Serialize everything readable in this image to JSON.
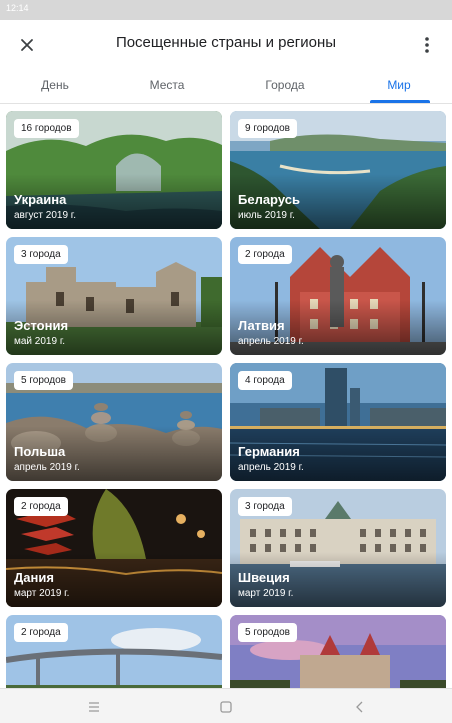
{
  "status_bar": {
    "left": "12:14",
    "right": ""
  },
  "app_bar": {
    "title": "Посещенные страны и регионы",
    "close_icon": "close-icon",
    "more_icon": "more-vert-icon"
  },
  "tabs": [
    {
      "label": "День"
    },
    {
      "label": "Места"
    },
    {
      "label": "Города"
    },
    {
      "label": "Мир"
    }
  ],
  "active_tab": "Мир",
  "accent_color": "#1a73e8",
  "countries": [
    {
      "name": "Украина",
      "date": "август 2019 г.",
      "cities": "16 городов"
    },
    {
      "name": "Беларусь",
      "date": "июль 2019 г.",
      "cities": "9 городов"
    },
    {
      "name": "Эстония",
      "date": "май 2019 г.",
      "cities": "3 города"
    },
    {
      "name": "Латвия",
      "date": "апрель 2019 г.",
      "cities": "2 города"
    },
    {
      "name": "Польша",
      "date": "апрель 2019 г.",
      "cities": "5 городов"
    },
    {
      "name": "Германия",
      "date": "апрель 2019 г.",
      "cities": "4 города"
    },
    {
      "name": "Дания",
      "date": "март 2019 г.",
      "cities": "2 города"
    },
    {
      "name": "Швеция",
      "date": "март 2019 г.",
      "cities": "3 города"
    },
    {
      "name": "",
      "date": "",
      "cities": "2 города"
    },
    {
      "name": "",
      "date": "",
      "cities": "5 городов"
    }
  ],
  "nav_bar": {
    "icons": [
      "menu-icon",
      "home-icon",
      "back-icon"
    ]
  }
}
